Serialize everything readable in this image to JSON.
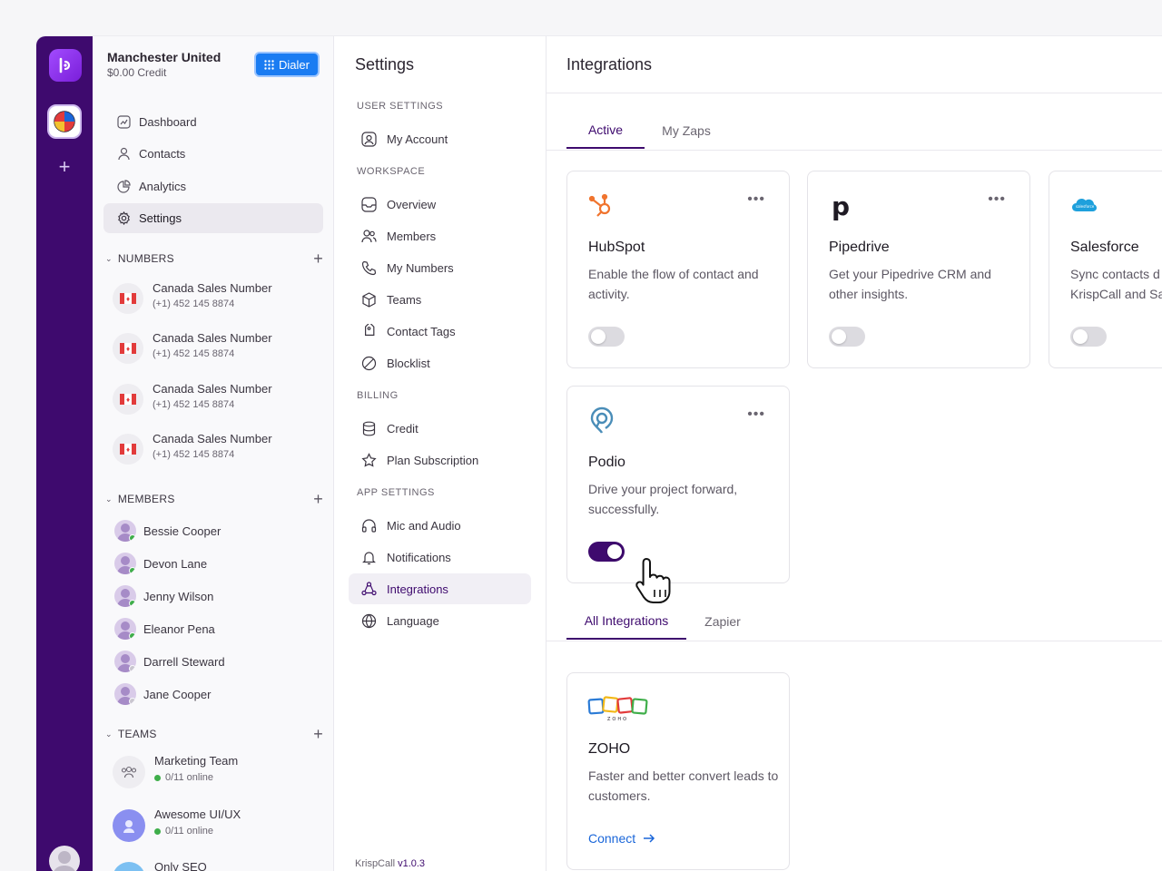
{
  "workspace": {
    "name": "Manchester United",
    "credit": "$0.00 Credit",
    "dialer_label": "Dialer"
  },
  "nav": [
    {
      "label": "Dashboard",
      "icon": "dashboard-icon"
    },
    {
      "label": "Contacts",
      "icon": "contacts-icon"
    },
    {
      "label": "Analytics",
      "icon": "analytics-icon"
    },
    {
      "label": "Settings",
      "icon": "settings-icon",
      "active": true
    }
  ],
  "numbers": {
    "heading": "NUMBERS",
    "items": [
      {
        "name": "Canada Sales Number",
        "phone": "(+1) 452 145 8874"
      },
      {
        "name": "Canada Sales Number",
        "phone": "(+1) 452 145 8874"
      },
      {
        "name": "Canada Sales Number",
        "phone": "(+1) 452 145 8874"
      },
      {
        "name": "Canada Sales Number",
        "phone": "(+1) 452 145 8874"
      }
    ]
  },
  "members": {
    "heading": "MEMBERS",
    "items": [
      {
        "name": "Bessie Cooper",
        "status": "online"
      },
      {
        "name": "Devon Lane",
        "status": "online"
      },
      {
        "name": "Jenny Wilson",
        "status": "online"
      },
      {
        "name": "Eleanor Pena",
        "status": "online"
      },
      {
        "name": "Darrell Steward",
        "status": "offline"
      },
      {
        "name": "Jane Cooper",
        "status": "offline"
      }
    ]
  },
  "teams": {
    "heading": "TEAMS",
    "items": [
      {
        "name": "Marketing Team",
        "online": "0/11 online"
      },
      {
        "name": "Awesome UI/UX",
        "online": "0/11 online"
      },
      {
        "name": "Only SEO",
        "online": ""
      }
    ]
  },
  "settings": {
    "title": "Settings",
    "sections": {
      "user": "USER SETTINGS",
      "workspace": "WORKSPACE",
      "billing": "BILLING",
      "app": "APP SETTINGS"
    },
    "items": {
      "my_account": "My Account",
      "overview": "Overview",
      "members": "Members",
      "my_numbers": "My Numbers",
      "teams": "Teams",
      "contact_tags": "Contact Tags",
      "blocklist": "Blocklist",
      "credit": "Credit",
      "plan_subscription": "Plan Subscription",
      "mic_audio": "Mic and Audio",
      "notifications": "Notifications",
      "integrations": "Integrations",
      "language": "Language"
    },
    "version_prefix": "KrispCall",
    "version": "v1.0.3"
  },
  "main": {
    "title": "Integrations",
    "top_tabs": [
      "Active",
      "My Zaps"
    ],
    "active_cards": [
      {
        "name": "HubSpot",
        "desc": "Enable the flow of contact and activity.",
        "enabled": false
      },
      {
        "name": "Pipedrive",
        "desc": "Get your Pipedrive CRM and other insights.",
        "enabled": false
      },
      {
        "name": "Salesforce",
        "desc": "Sync contacts d KrispCall and Sa",
        "enabled": false
      },
      {
        "name": "Podio",
        "desc": "Drive your project forward, successfully.",
        "enabled": true
      }
    ],
    "bottom_tabs": [
      "All Integrations",
      "Zapier"
    ],
    "all_cards": [
      {
        "name": "ZOHO",
        "desc": "Faster and better convert leads to customers.",
        "action": "Connect"
      }
    ]
  },
  "colors": {
    "brand": "#3e0a6e",
    "dialer": "#1a7cf2",
    "online": "#3fae4a",
    "link": "#1a66d9"
  }
}
